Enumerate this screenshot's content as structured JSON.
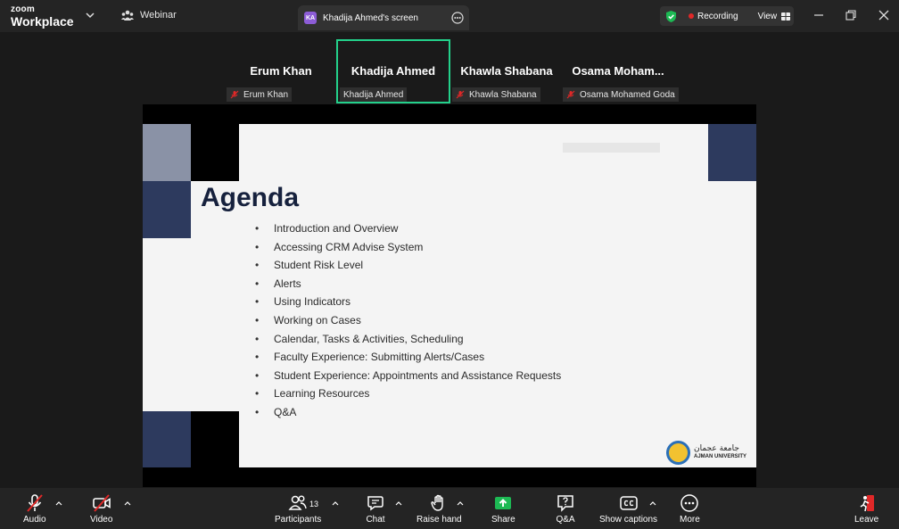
{
  "titlebar": {
    "brand_line1": "zoom",
    "brand_line2": "Workplace",
    "webinar_label": "Webinar",
    "share_tab": {
      "initials": "KA",
      "title": "Khadija Ahmed's screen"
    },
    "recording_label": "Recording",
    "view_label": "View"
  },
  "participants": [
    {
      "name": "Erum Khan",
      "tag": "Erum Khan",
      "muted": true
    },
    {
      "name": "Khadija Ahmed",
      "tag": "Khadija Ahmed",
      "muted": false,
      "active": true
    },
    {
      "name": "Khawla Shabana",
      "tag": "Khawla Shabana",
      "muted": true
    },
    {
      "name": "Osama Moham...",
      "tag": "Osama Mohamed Goda",
      "muted": true
    }
  ],
  "slide": {
    "title": "Agenda",
    "items": [
      "Introduction and Overview",
      "Accessing CRM Advise System",
      "Student Risk Level",
      "Alerts",
      "Using Indicators",
      "Working on Cases",
      "Calendar, Tasks & Activities, Scheduling",
      "Faculty Experience: Submitting Alerts/Cases",
      "Student Experience: Appointments and Assistance Requests",
      "Learning Resources",
      "Q&A"
    ],
    "logo_arabic": "جامعة عجمان",
    "logo_english": "AJMAN UNIVERSITY",
    "accent_dark": "#2d3a5e",
    "accent_gray": "#8a92a6"
  },
  "toolbar": {
    "audio": "Audio",
    "video": "Video",
    "participants": "Participants",
    "participants_count": "13",
    "chat": "Chat",
    "raise_hand": "Raise hand",
    "share": "Share",
    "qa": "Q&A",
    "captions": "Show captions",
    "more": "More",
    "leave": "Leave"
  },
  "colors": {
    "active_speaker": "#23d18b",
    "share_green": "#1db954",
    "leave_red": "#e02828"
  }
}
